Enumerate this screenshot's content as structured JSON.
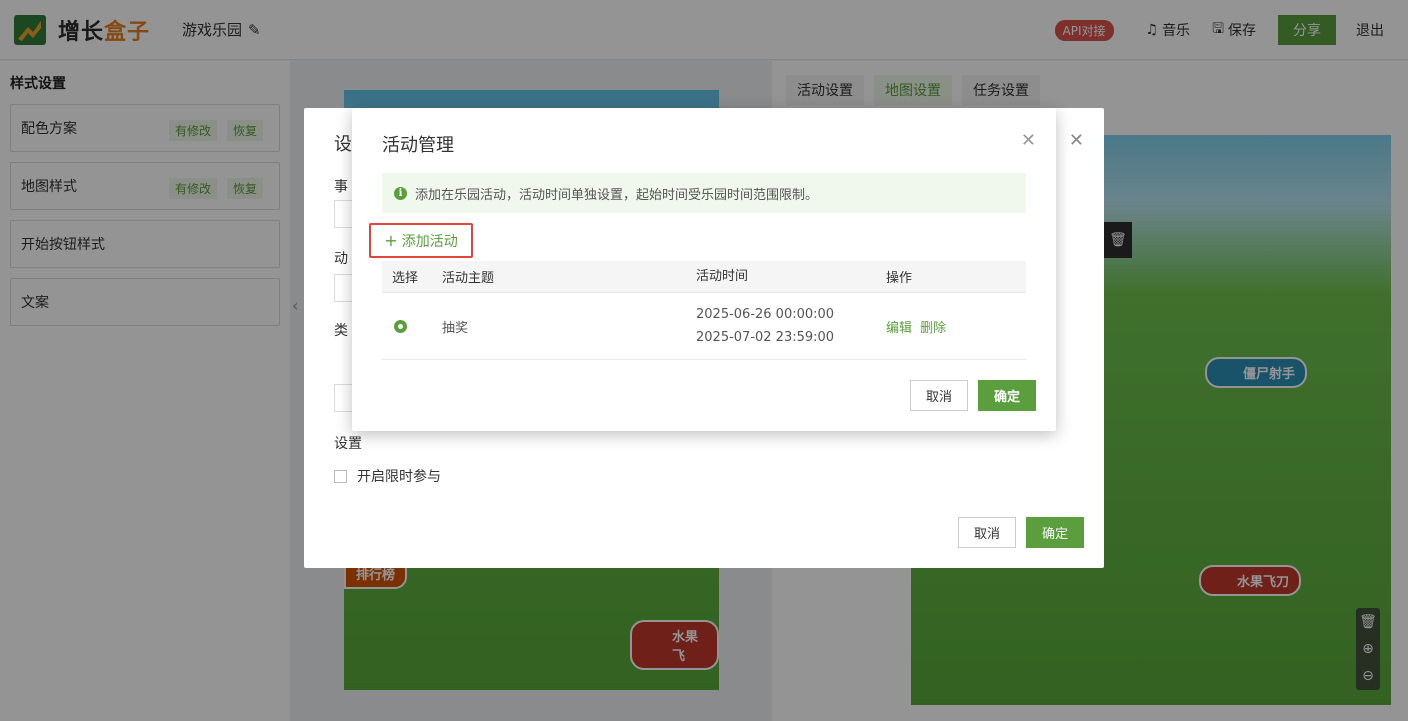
{
  "header": {
    "brand_part1": "增长",
    "brand_part2": "盒子",
    "project_name": "游戏乐园",
    "api_badge": "API对接",
    "music_label": "音乐",
    "save_label": "保存",
    "share_label": "分享",
    "exit_label": "退出"
  },
  "sidebar": {
    "title": "样式设置",
    "items": [
      {
        "label": "配色方案",
        "tag_modified": "有修改",
        "tag_restore": "恢复"
      },
      {
        "label": "地图样式",
        "tag_modified": "有修改",
        "tag_restore": "恢复"
      },
      {
        "label": "开始按钮样式"
      },
      {
        "label": "文案"
      }
    ]
  },
  "right_panel": {
    "tabs": [
      "活动设置",
      "地图设置",
      "任务设置"
    ],
    "active_tab": "地图设置"
  },
  "map_labels": {
    "label1": "僵尸射手",
    "label2": "水果飞刀",
    "label3": "水果飞",
    "label4": "排行榜"
  },
  "background_dialog": {
    "title": "设",
    "label_event": "事",
    "label_anim": "动",
    "label_type": "类",
    "label_settings": "设置",
    "checkbox_label": "开启限时参与",
    "cancel_label": "取消",
    "ok_label": "确定"
  },
  "modal": {
    "title": "活动管理",
    "alert_text": "添加在乐园活动，活动时间单独设置，起始时间受乐园时间范围限制。",
    "add_button": "添加活动",
    "columns": [
      "选择",
      "活动主题",
      "活动时间",
      "操作"
    ],
    "rows": [
      {
        "topic": "抽奖",
        "start": "2025-06-26 00:00:00",
        "end": "2025-07-02 23:59:00",
        "edit": "编辑",
        "delete": "删除"
      }
    ],
    "cancel_label": "取消",
    "ok_label": "确定"
  },
  "colors": {
    "accent": "#5a9e3e",
    "highlight_border": "#e0463a",
    "badge": "#d9534f"
  }
}
